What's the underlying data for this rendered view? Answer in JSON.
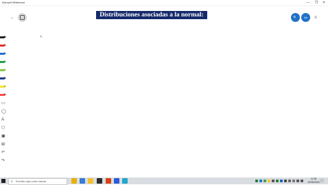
{
  "window": {
    "title": "Microsoft Whiteboard",
    "minimize": "—",
    "maximize": "❐",
    "close": "✕"
  },
  "header": {
    "back_icon": "←",
    "share_icon": "🔍",
    "avatar_initials": "AA",
    "menu_icon": "≡"
  },
  "canvas": {
    "title_text": "Distribuciones asociadas a la normal:",
    "title_bg": "#152a6b"
  },
  "toolbar": {
    "pens": [
      {
        "name": "black-pen",
        "color": "#222222"
      },
      {
        "name": "red-pen",
        "color": "#e0322b"
      },
      {
        "name": "blue-pen",
        "color": "#1d6fd1"
      },
      {
        "name": "green-pen",
        "color": "#21a045"
      },
      {
        "name": "lime-pen",
        "color": "#8bc34a"
      },
      {
        "name": "navy-pen",
        "color": "#1c3c8c"
      },
      {
        "name": "yellow-highlighter",
        "color": "#f3e23a"
      },
      {
        "name": "red-highlighter",
        "color": "#ff4a4a"
      }
    ],
    "tools": [
      {
        "name": "ruler-icon",
        "glyph": "▭"
      },
      {
        "name": "lasso-icon",
        "glyph": "◯"
      },
      {
        "name": "text-icon",
        "glyph": "A"
      },
      {
        "name": "shape-icon",
        "glyph": "⬡"
      },
      {
        "name": "image-icon",
        "glyph": "▣"
      },
      {
        "name": "insert-icon",
        "glyph": "⊞"
      },
      {
        "name": "undo-icon",
        "glyph": "↶"
      },
      {
        "name": "redo-icon",
        "glyph": "↷"
      }
    ]
  },
  "taskbar": {
    "search_placeholder": "Escribe aquí para buscar",
    "apps": [
      {
        "name": "chrome",
        "color": "#e8b100"
      },
      {
        "name": "whiteboard-app",
        "color": "#3a7bd5"
      },
      {
        "name": "file-explorer",
        "color": "#f2c12e"
      },
      {
        "name": "app-dark",
        "color": "#2b2b2b"
      },
      {
        "name": "app-orange",
        "color": "#d84315"
      },
      {
        "name": "app-blue",
        "color": "#2a5bd7"
      },
      {
        "name": "app-teal",
        "color": "#23a6c9"
      }
    ],
    "time": "11:28",
    "date": "12/06/2020"
  }
}
